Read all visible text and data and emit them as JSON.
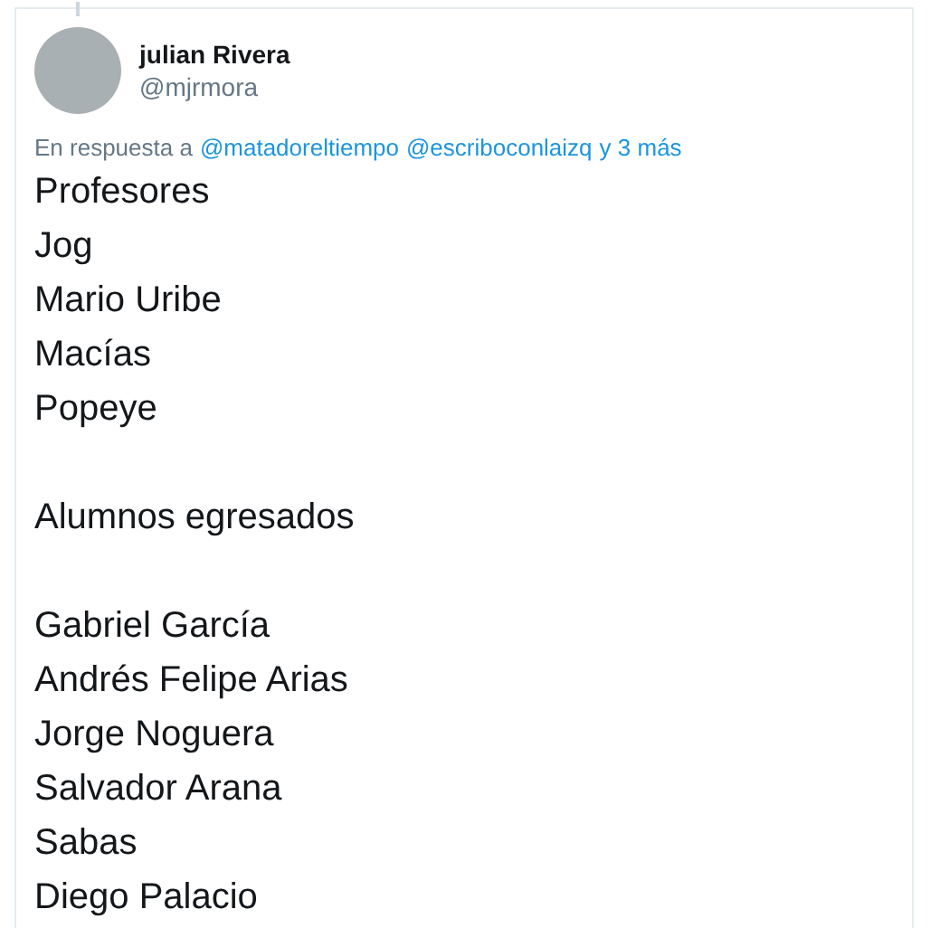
{
  "author": {
    "name": "julian Rivera",
    "handle": "@mjrmora"
  },
  "reply": {
    "prefix": "En respuesta a",
    "mentions": [
      "@matadoreltiempo",
      "@escriboconlaizq"
    ],
    "more": "y 3 más"
  },
  "body": [
    [
      "Profesores",
      "Jog",
      "Mario Uribe",
      "Macías",
      "Popeye"
    ],
    [
      "Alumnos egresados"
    ],
    [
      "Gabriel García",
      "Andrés Felipe Arias",
      "Jorge Noguera",
      "Salvador Arana",
      "Sabas",
      "Diego Palacio"
    ]
  ]
}
